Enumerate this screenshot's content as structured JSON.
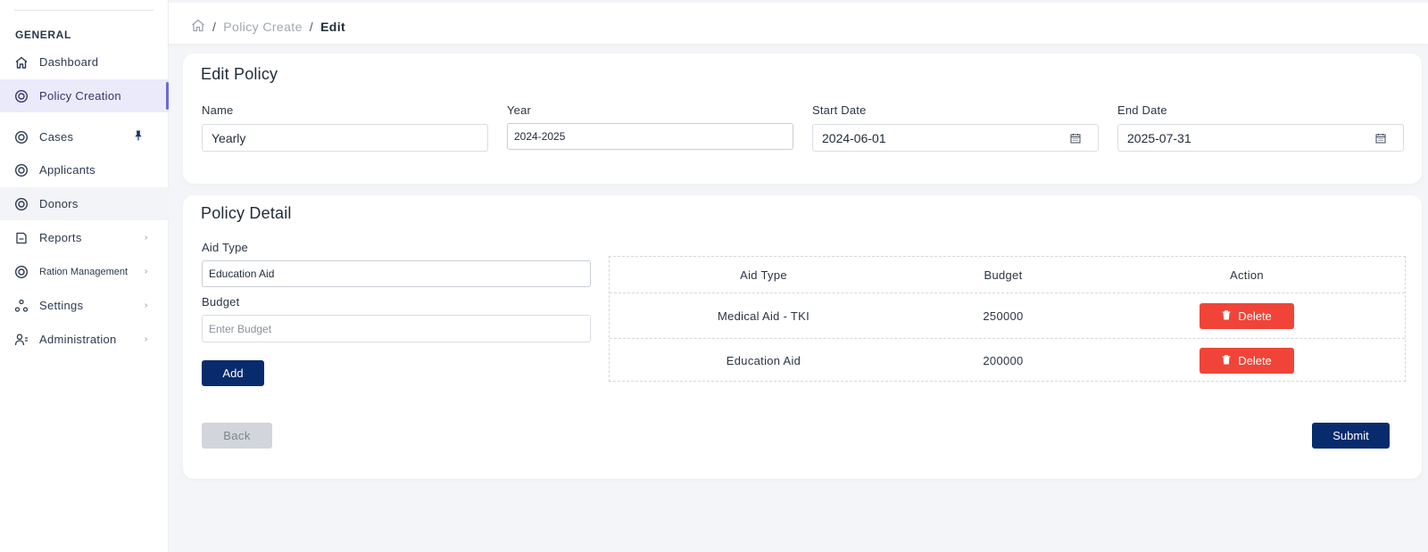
{
  "sidebar": {
    "section_label": "GENERAL",
    "items": [
      {
        "label": "Dashboard"
      },
      {
        "label": "Policy Creation"
      },
      {
        "label": "Cases"
      },
      {
        "label": "Applicants"
      },
      {
        "label": "Donors"
      },
      {
        "label": "Reports"
      },
      {
        "label": "Ration Management"
      },
      {
        "label": "Settings"
      },
      {
        "label": "Administration"
      }
    ]
  },
  "breadcrumb": {
    "crumb1": "Policy Create",
    "current": "Edit",
    "separator": "/"
  },
  "edit_policy": {
    "title": "Edit Policy",
    "name_label": "Name",
    "name_value": "Yearly",
    "year_label": "Year",
    "year_value": "2024-2025",
    "start_label": "Start Date",
    "start_value": "2024-06-01",
    "end_label": "End Date",
    "end_value": "2025-07-31"
  },
  "policy_detail": {
    "title": "Policy Detail",
    "aid_type_label": "Aid Type",
    "aid_type_value": "Education Aid",
    "budget_label": "Budget",
    "budget_placeholder": "Enter Budget",
    "add_label": "Add",
    "table": {
      "headers": [
        "Aid Type",
        "Budget",
        "Action"
      ],
      "rows": [
        {
          "aid_type": "Medical Aid - TKI",
          "budget": "250000",
          "action": "Delete"
        },
        {
          "aid_type": "Education Aid",
          "budget": "200000",
          "action": "Delete"
        }
      ]
    },
    "back_label": "Back",
    "submit_label": "Submit"
  },
  "colors": {
    "primary": "#082b6d",
    "danger": "#f04438",
    "active_bg": "#ebeafa",
    "active_bar": "#7067d6"
  }
}
